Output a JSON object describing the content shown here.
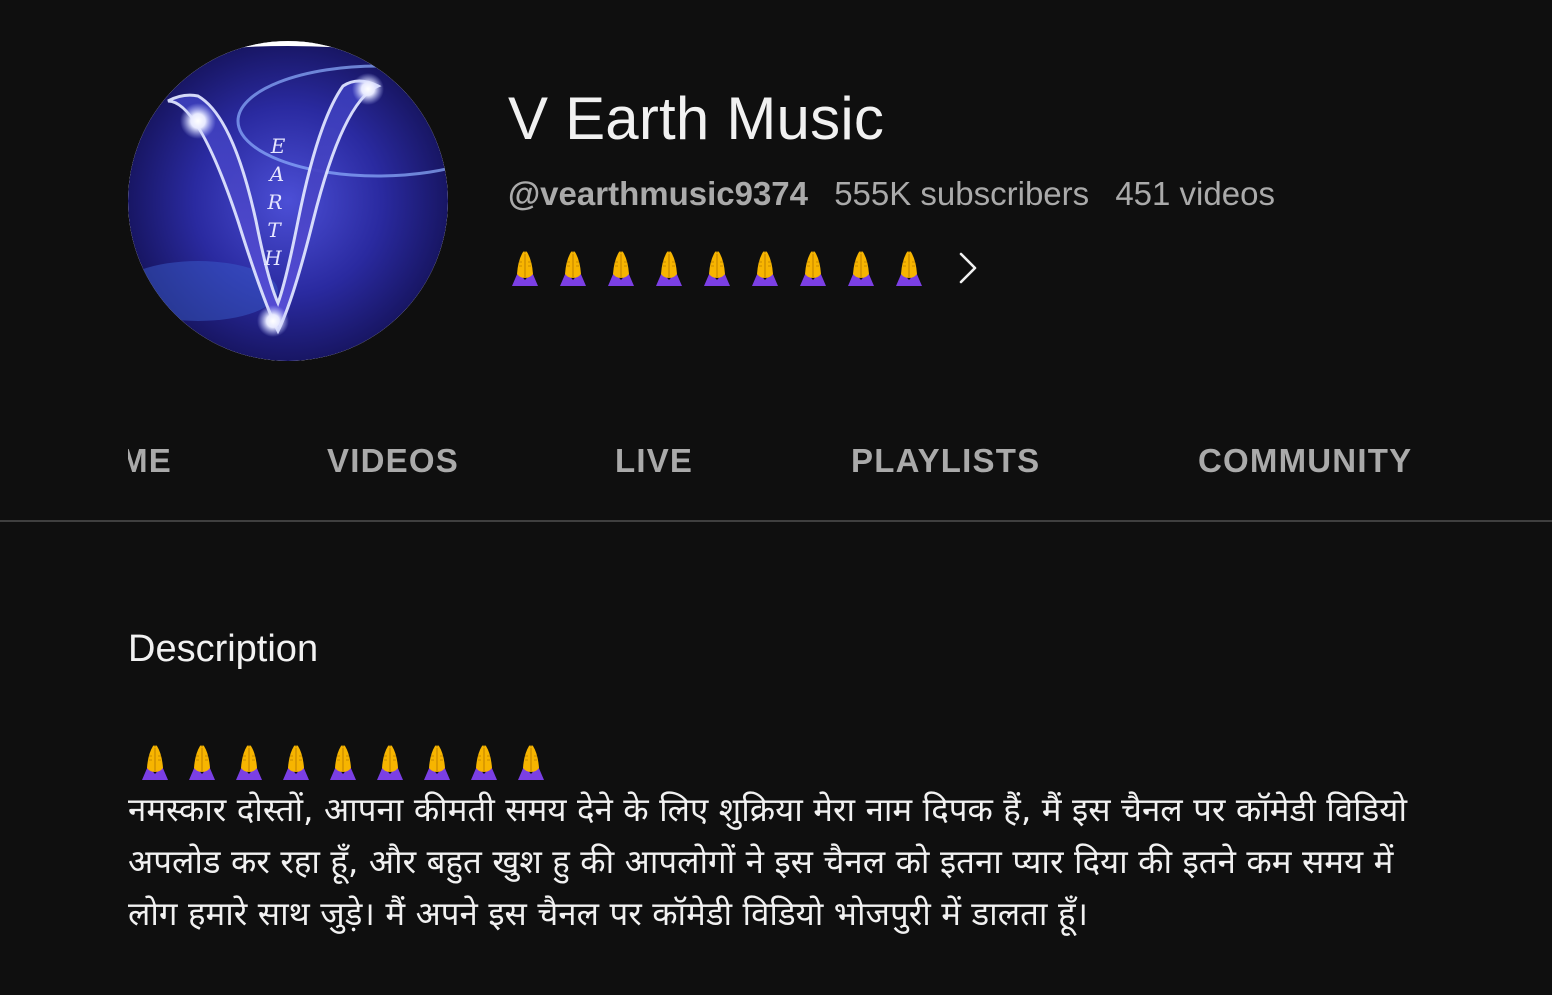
{
  "channel": {
    "name": "V Earth Music",
    "handle": "@vearthmusic9374",
    "subscribers": "555K subscribers",
    "videos": "451 videos",
    "tagline_emojis": [
      "folded-hands",
      "folded-hands",
      "folded-hands",
      "folded-hands",
      "folded-hands",
      "folded-hands",
      "folded-hands",
      "folded-hands",
      "folded-hands"
    ],
    "avatar_text": "EARTH"
  },
  "tabs": [
    {
      "label": "HOME"
    },
    {
      "label": "VIDEOS"
    },
    {
      "label": "LIVE"
    },
    {
      "label": "PLAYLISTS"
    },
    {
      "label": "COMMUNITY"
    }
  ],
  "description": {
    "heading": "Description",
    "emojis": [
      "folded-hands",
      "folded-hands",
      "folded-hands",
      "folded-hands",
      "folded-hands",
      "folded-hands",
      "folded-hands",
      "folded-hands",
      "folded-hands"
    ],
    "text": "नमस्कार दोस्तों, आपना कीमती समय देने के लिए शुक्रिया  मेरा नाम दिपक हैं, मैं इस चैनल पर कॉमेडी  विडियो अपलोड कर रहा हूँ, और बहुत खुश हु की आपलोगों ने इस चैनल को इतना प्यार दिया की इतने कम समय में  लोग हमारे साथ जुड़े। मैं अपने इस चैनल पर कॉमेडी विडियो भोजपुरी में डालता हूँ।"
  },
  "icons": {
    "chevron": "chevron-right-icon",
    "emoji": "folded-hands-icon"
  },
  "colors": {
    "background": "#0f0f0f",
    "text_primary": "#f1f1f1",
    "text_secondary": "#aaaaaa",
    "divider": "#3f3f3f",
    "emoji_sleeve": "#7b3fe4",
    "emoji_hands": "#f7b500"
  }
}
